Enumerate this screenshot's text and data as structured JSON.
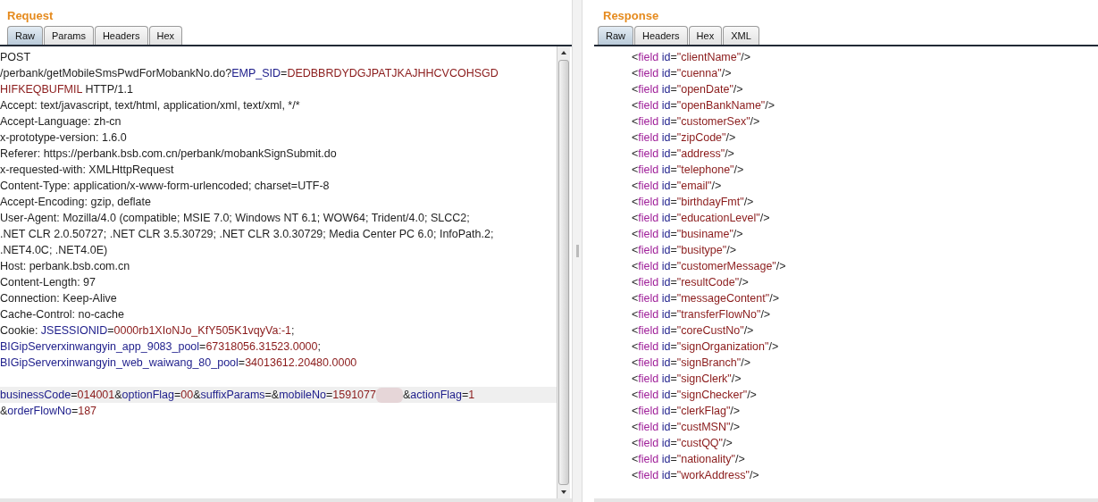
{
  "request": {
    "title": "Request",
    "tabs": [
      {
        "label": "Raw",
        "selected": true
      },
      {
        "label": "Params",
        "selected": false
      },
      {
        "label": "Headers",
        "selected": false
      },
      {
        "label": "Hex",
        "selected": false
      }
    ],
    "lines": [
      {
        "highlighted": false,
        "segments": [
          {
            "kind": "plain",
            "text": "POST"
          }
        ]
      },
      {
        "highlighted": false,
        "segments": [
          {
            "kind": "plain",
            "text": "/perbank/getMobileSmsPwdForMobankNo.do?"
          },
          {
            "kind": "key",
            "text": "EMP_SID"
          },
          {
            "kind": "plain",
            "text": "="
          },
          {
            "kind": "value",
            "text": "DEDBBRDYDGJPATJKAJHHCVCOHSGD"
          }
        ]
      },
      {
        "highlighted": false,
        "segments": [
          {
            "kind": "value",
            "text": "HIFKEQBUFMIL"
          },
          {
            "kind": "plain",
            "text": " HTTP/1.1"
          }
        ]
      },
      {
        "highlighted": false,
        "segments": [
          {
            "kind": "plain",
            "text": "Accept: text/javascript, text/html, application/xml, text/xml, */*"
          }
        ]
      },
      {
        "highlighted": false,
        "segments": [
          {
            "kind": "plain",
            "text": "Accept-Language: zh-cn"
          }
        ]
      },
      {
        "highlighted": false,
        "segments": [
          {
            "kind": "plain",
            "text": "x-prototype-version: 1.6.0"
          }
        ]
      },
      {
        "highlighted": false,
        "segments": [
          {
            "kind": "plain",
            "text": "Referer: https://perbank.bsb.com.cn/perbank/mobankSignSubmit.do"
          }
        ]
      },
      {
        "highlighted": false,
        "segments": [
          {
            "kind": "plain",
            "text": "x-requested-with: XMLHttpRequest"
          }
        ]
      },
      {
        "highlighted": false,
        "segments": [
          {
            "kind": "plain",
            "text": "Content-Type: application/x-www-form-urlencoded; charset=UTF-8"
          }
        ]
      },
      {
        "highlighted": false,
        "segments": [
          {
            "kind": "plain",
            "text": "Accept-Encoding: gzip, deflate"
          }
        ]
      },
      {
        "highlighted": false,
        "segments": [
          {
            "kind": "plain",
            "text": "User-Agent: Mozilla/4.0 (compatible; MSIE 7.0; Windows NT 6.1; WOW64; Trident/4.0; SLCC2;"
          }
        ]
      },
      {
        "highlighted": false,
        "segments": [
          {
            "kind": "plain",
            "text": ".NET CLR 2.0.50727; .NET CLR 3.5.30729; .NET CLR 3.0.30729; Media Center PC 6.0; InfoPath.2;"
          }
        ]
      },
      {
        "highlighted": false,
        "segments": [
          {
            "kind": "plain",
            "text": ".NET4.0C; .NET4.0E)"
          }
        ]
      },
      {
        "highlighted": false,
        "segments": [
          {
            "kind": "plain",
            "text": "Host: perbank.bsb.com.cn"
          }
        ]
      },
      {
        "highlighted": false,
        "segments": [
          {
            "kind": "plain",
            "text": "Content-Length: 97"
          }
        ]
      },
      {
        "highlighted": false,
        "segments": [
          {
            "kind": "plain",
            "text": "Connection: Keep-Alive"
          }
        ]
      },
      {
        "highlighted": false,
        "segments": [
          {
            "kind": "plain",
            "text": "Cache-Control: no-cache"
          }
        ]
      },
      {
        "highlighted": false,
        "segments": [
          {
            "kind": "plain",
            "text": "Cookie: "
          },
          {
            "kind": "key",
            "text": "JSESSIONID"
          },
          {
            "kind": "plain",
            "text": "="
          },
          {
            "kind": "value",
            "text": "0000rb1XIoNJo_KfY505K1vqyVa:-1"
          },
          {
            "kind": "plain",
            "text": ";"
          }
        ]
      },
      {
        "highlighted": false,
        "segments": [
          {
            "kind": "key",
            "text": "BIGipServerxinwangyin_app_9083_pool"
          },
          {
            "kind": "plain",
            "text": "="
          },
          {
            "kind": "value",
            "text": "67318056.31523.0000"
          },
          {
            "kind": "plain",
            "text": ";"
          }
        ]
      },
      {
        "highlighted": false,
        "segments": [
          {
            "kind": "key",
            "text": "BIGipServerxinwangyin_web_waiwang_80_pool"
          },
          {
            "kind": "plain",
            "text": "="
          },
          {
            "kind": "value",
            "text": "34013612.20480.0000"
          }
        ]
      },
      {
        "highlighted": false
      },
      {
        "highlighted": true,
        "segments": [
          {
            "kind": "key",
            "text": "businessCode"
          },
          {
            "kind": "plain",
            "text": "="
          },
          {
            "kind": "value",
            "text": "014001"
          },
          {
            "kind": "plain",
            "text": "&"
          },
          {
            "kind": "key",
            "text": "optionFlag"
          },
          {
            "kind": "plain",
            "text": "="
          },
          {
            "kind": "value",
            "text": "00"
          },
          {
            "kind": "plain",
            "text": "&"
          },
          {
            "kind": "key",
            "text": "suffixParams"
          },
          {
            "kind": "plain",
            "text": "=&"
          },
          {
            "kind": "key",
            "text": "mobileNo"
          },
          {
            "kind": "plain",
            "text": "="
          },
          {
            "kind": "value",
            "text": "1591077"
          },
          {
            "kind": "redacted"
          },
          {
            "kind": "plain",
            "text": "&"
          },
          {
            "kind": "key",
            "text": "actionFlag"
          },
          {
            "kind": "plain",
            "text": "="
          },
          {
            "kind": "value",
            "text": "1"
          }
        ]
      },
      {
        "highlighted": false,
        "segments": [
          {
            "kind": "plain",
            "text": "&"
          },
          {
            "kind": "key",
            "text": "orderFlowNo"
          },
          {
            "kind": "plain",
            "text": "="
          },
          {
            "kind": "value",
            "text": "187"
          }
        ]
      }
    ]
  },
  "response": {
    "title": "Response",
    "tabs": [
      {
        "label": "Raw",
        "selected": true
      },
      {
        "label": "Headers",
        "selected": false
      },
      {
        "label": "Hex",
        "selected": false
      },
      {
        "label": "XML",
        "selected": false
      }
    ],
    "lines": [
      [
        {
          "kind": "punct",
          "text": "<"
        },
        {
          "kind": "tag",
          "text": "field"
        },
        {
          "kind": "attr",
          "text": " id"
        },
        {
          "kind": "punct",
          "text": "="
        },
        {
          "kind": "value",
          "text": "\"clientName\""
        },
        {
          "kind": "punct",
          "text": "/>"
        }
      ],
      [
        {
          "kind": "punct",
          "text": "<"
        },
        {
          "kind": "tag",
          "text": "field"
        },
        {
          "kind": "attr",
          "text": " id"
        },
        {
          "kind": "punct",
          "text": "="
        },
        {
          "kind": "value",
          "text": "\"cuenna\""
        },
        {
          "kind": "punct",
          "text": "/>"
        }
      ],
      [
        {
          "kind": "punct",
          "text": "<"
        },
        {
          "kind": "tag",
          "text": "field"
        },
        {
          "kind": "attr",
          "text": " id"
        },
        {
          "kind": "punct",
          "text": "="
        },
        {
          "kind": "value",
          "text": "\"openDate\""
        },
        {
          "kind": "punct",
          "text": "/>"
        }
      ],
      [
        {
          "kind": "punct",
          "text": "<"
        },
        {
          "kind": "tag",
          "text": "field"
        },
        {
          "kind": "attr",
          "text": " id"
        },
        {
          "kind": "punct",
          "text": "="
        },
        {
          "kind": "value",
          "text": "\"openBankName\""
        },
        {
          "kind": "punct",
          "text": "/>"
        }
      ],
      [
        {
          "kind": "punct",
          "text": "<"
        },
        {
          "kind": "tag",
          "text": "field"
        },
        {
          "kind": "attr",
          "text": " id"
        },
        {
          "kind": "punct",
          "text": "="
        },
        {
          "kind": "value",
          "text": "\"customerSex\""
        },
        {
          "kind": "punct",
          "text": "/>"
        }
      ],
      [
        {
          "kind": "punct",
          "text": "<"
        },
        {
          "kind": "tag",
          "text": "field"
        },
        {
          "kind": "attr",
          "text": " id"
        },
        {
          "kind": "punct",
          "text": "="
        },
        {
          "kind": "value",
          "text": "\"zipCode\""
        },
        {
          "kind": "punct",
          "text": "/>"
        }
      ],
      [
        {
          "kind": "punct",
          "text": "<"
        },
        {
          "kind": "tag",
          "text": "field"
        },
        {
          "kind": "attr",
          "text": " id"
        },
        {
          "kind": "punct",
          "text": "="
        },
        {
          "kind": "value",
          "text": "\"address\""
        },
        {
          "kind": "punct",
          "text": "/>"
        }
      ],
      [
        {
          "kind": "punct",
          "text": "<"
        },
        {
          "kind": "tag",
          "text": "field"
        },
        {
          "kind": "attr",
          "text": " id"
        },
        {
          "kind": "punct",
          "text": "="
        },
        {
          "kind": "value",
          "text": "\"telephone\""
        },
        {
          "kind": "punct",
          "text": "/>"
        }
      ],
      [
        {
          "kind": "punct",
          "text": "<"
        },
        {
          "kind": "tag",
          "text": "field"
        },
        {
          "kind": "attr",
          "text": " id"
        },
        {
          "kind": "punct",
          "text": "="
        },
        {
          "kind": "value",
          "text": "\"email\""
        },
        {
          "kind": "punct",
          "text": "/>"
        }
      ],
      [
        {
          "kind": "punct",
          "text": "<"
        },
        {
          "kind": "tag",
          "text": "field"
        },
        {
          "kind": "attr",
          "text": " id"
        },
        {
          "kind": "punct",
          "text": "="
        },
        {
          "kind": "value",
          "text": "\"birthdayFmt\""
        },
        {
          "kind": "punct",
          "text": "/>"
        }
      ],
      [
        {
          "kind": "punct",
          "text": "<"
        },
        {
          "kind": "tag",
          "text": "field"
        },
        {
          "kind": "attr",
          "text": " id"
        },
        {
          "kind": "punct",
          "text": "="
        },
        {
          "kind": "value",
          "text": "\"educationLevel\""
        },
        {
          "kind": "punct",
          "text": "/>"
        }
      ],
      [
        {
          "kind": "punct",
          "text": "<"
        },
        {
          "kind": "tag",
          "text": "field"
        },
        {
          "kind": "attr",
          "text": " id"
        },
        {
          "kind": "punct",
          "text": "="
        },
        {
          "kind": "value",
          "text": "\"businame\""
        },
        {
          "kind": "punct",
          "text": "/>"
        }
      ],
      [
        {
          "kind": "punct",
          "text": "<"
        },
        {
          "kind": "tag",
          "text": "field"
        },
        {
          "kind": "attr",
          "text": " id"
        },
        {
          "kind": "punct",
          "text": "="
        },
        {
          "kind": "value",
          "text": "\"busitype\""
        },
        {
          "kind": "punct",
          "text": "/>"
        }
      ],
      [
        {
          "kind": "punct",
          "text": "<"
        },
        {
          "kind": "tag",
          "text": "field"
        },
        {
          "kind": "attr",
          "text": " id"
        },
        {
          "kind": "punct",
          "text": "="
        },
        {
          "kind": "value",
          "text": "\"customerMessage\""
        },
        {
          "kind": "punct",
          "text": "/>"
        }
      ],
      [
        {
          "kind": "punct",
          "text": "<"
        },
        {
          "kind": "tag",
          "text": "field"
        },
        {
          "kind": "attr",
          "text": " id"
        },
        {
          "kind": "punct",
          "text": "="
        },
        {
          "kind": "value",
          "text": "\"resultCode\""
        },
        {
          "kind": "punct",
          "text": "/>"
        }
      ],
      [
        {
          "kind": "punct",
          "text": "<"
        },
        {
          "kind": "tag",
          "text": "field"
        },
        {
          "kind": "attr",
          "text": " id"
        },
        {
          "kind": "punct",
          "text": "="
        },
        {
          "kind": "value",
          "text": "\"messageContent\""
        },
        {
          "kind": "punct",
          "text": "/>"
        }
      ],
      [
        {
          "kind": "punct",
          "text": "<"
        },
        {
          "kind": "tag",
          "text": "field"
        },
        {
          "kind": "attr",
          "text": " id"
        },
        {
          "kind": "punct",
          "text": "="
        },
        {
          "kind": "value",
          "text": "\"transferFlowNo\""
        },
        {
          "kind": "punct",
          "text": "/>"
        }
      ],
      [
        {
          "kind": "punct",
          "text": "<"
        },
        {
          "kind": "tag",
          "text": "field"
        },
        {
          "kind": "attr",
          "text": " id"
        },
        {
          "kind": "punct",
          "text": "="
        },
        {
          "kind": "value",
          "text": "\"coreCustNo\""
        },
        {
          "kind": "punct",
          "text": "/>"
        }
      ],
      [
        {
          "kind": "punct",
          "text": "<"
        },
        {
          "kind": "tag",
          "text": "field"
        },
        {
          "kind": "attr",
          "text": " id"
        },
        {
          "kind": "punct",
          "text": "="
        },
        {
          "kind": "value",
          "text": "\"signOrganization\""
        },
        {
          "kind": "punct",
          "text": "/>"
        }
      ],
      [
        {
          "kind": "punct",
          "text": "<"
        },
        {
          "kind": "tag",
          "text": "field"
        },
        {
          "kind": "attr",
          "text": " id"
        },
        {
          "kind": "punct",
          "text": "="
        },
        {
          "kind": "value",
          "text": "\"signBranch\""
        },
        {
          "kind": "punct",
          "text": "/>"
        }
      ],
      [
        {
          "kind": "punct",
          "text": "<"
        },
        {
          "kind": "tag",
          "text": "field"
        },
        {
          "kind": "attr",
          "text": " id"
        },
        {
          "kind": "punct",
          "text": "="
        },
        {
          "kind": "value",
          "text": "\"signClerk\""
        },
        {
          "kind": "punct",
          "text": "/>"
        }
      ],
      [
        {
          "kind": "punct",
          "text": "<"
        },
        {
          "kind": "tag",
          "text": "field"
        },
        {
          "kind": "attr",
          "text": " id"
        },
        {
          "kind": "punct",
          "text": "="
        },
        {
          "kind": "value",
          "text": "\"signChecker\""
        },
        {
          "kind": "punct",
          "text": "/>"
        }
      ],
      [
        {
          "kind": "punct",
          "text": "<"
        },
        {
          "kind": "tag",
          "text": "field"
        },
        {
          "kind": "attr",
          "text": " id"
        },
        {
          "kind": "punct",
          "text": "="
        },
        {
          "kind": "value",
          "text": "\"clerkFlag\""
        },
        {
          "kind": "punct",
          "text": "/>"
        }
      ],
      [
        {
          "kind": "punct",
          "text": "<"
        },
        {
          "kind": "tag",
          "text": "field"
        },
        {
          "kind": "attr",
          "text": " id"
        },
        {
          "kind": "punct",
          "text": "="
        },
        {
          "kind": "value",
          "text": "\"custMSN\""
        },
        {
          "kind": "punct",
          "text": "/>"
        }
      ],
      [
        {
          "kind": "punct",
          "text": "<"
        },
        {
          "kind": "tag",
          "text": "field"
        },
        {
          "kind": "attr",
          "text": " id"
        },
        {
          "kind": "punct",
          "text": "="
        },
        {
          "kind": "value",
          "text": "\"custQQ\""
        },
        {
          "kind": "punct",
          "text": "/>"
        }
      ],
      [
        {
          "kind": "punct",
          "text": "<"
        },
        {
          "kind": "tag",
          "text": "field"
        },
        {
          "kind": "attr",
          "text": " id"
        },
        {
          "kind": "punct",
          "text": "="
        },
        {
          "kind": "value",
          "text": "\"nationality\""
        },
        {
          "kind": "punct",
          "text": "/>"
        }
      ],
      [
        {
          "kind": "punct",
          "text": "<"
        },
        {
          "kind": "tag",
          "text": "field"
        },
        {
          "kind": "attr",
          "text": " id"
        },
        {
          "kind": "punct",
          "text": "="
        },
        {
          "kind": "value",
          "text": "\"workAddress\""
        },
        {
          "kind": "punct",
          "text": "/>"
        }
      ]
    ]
  }
}
